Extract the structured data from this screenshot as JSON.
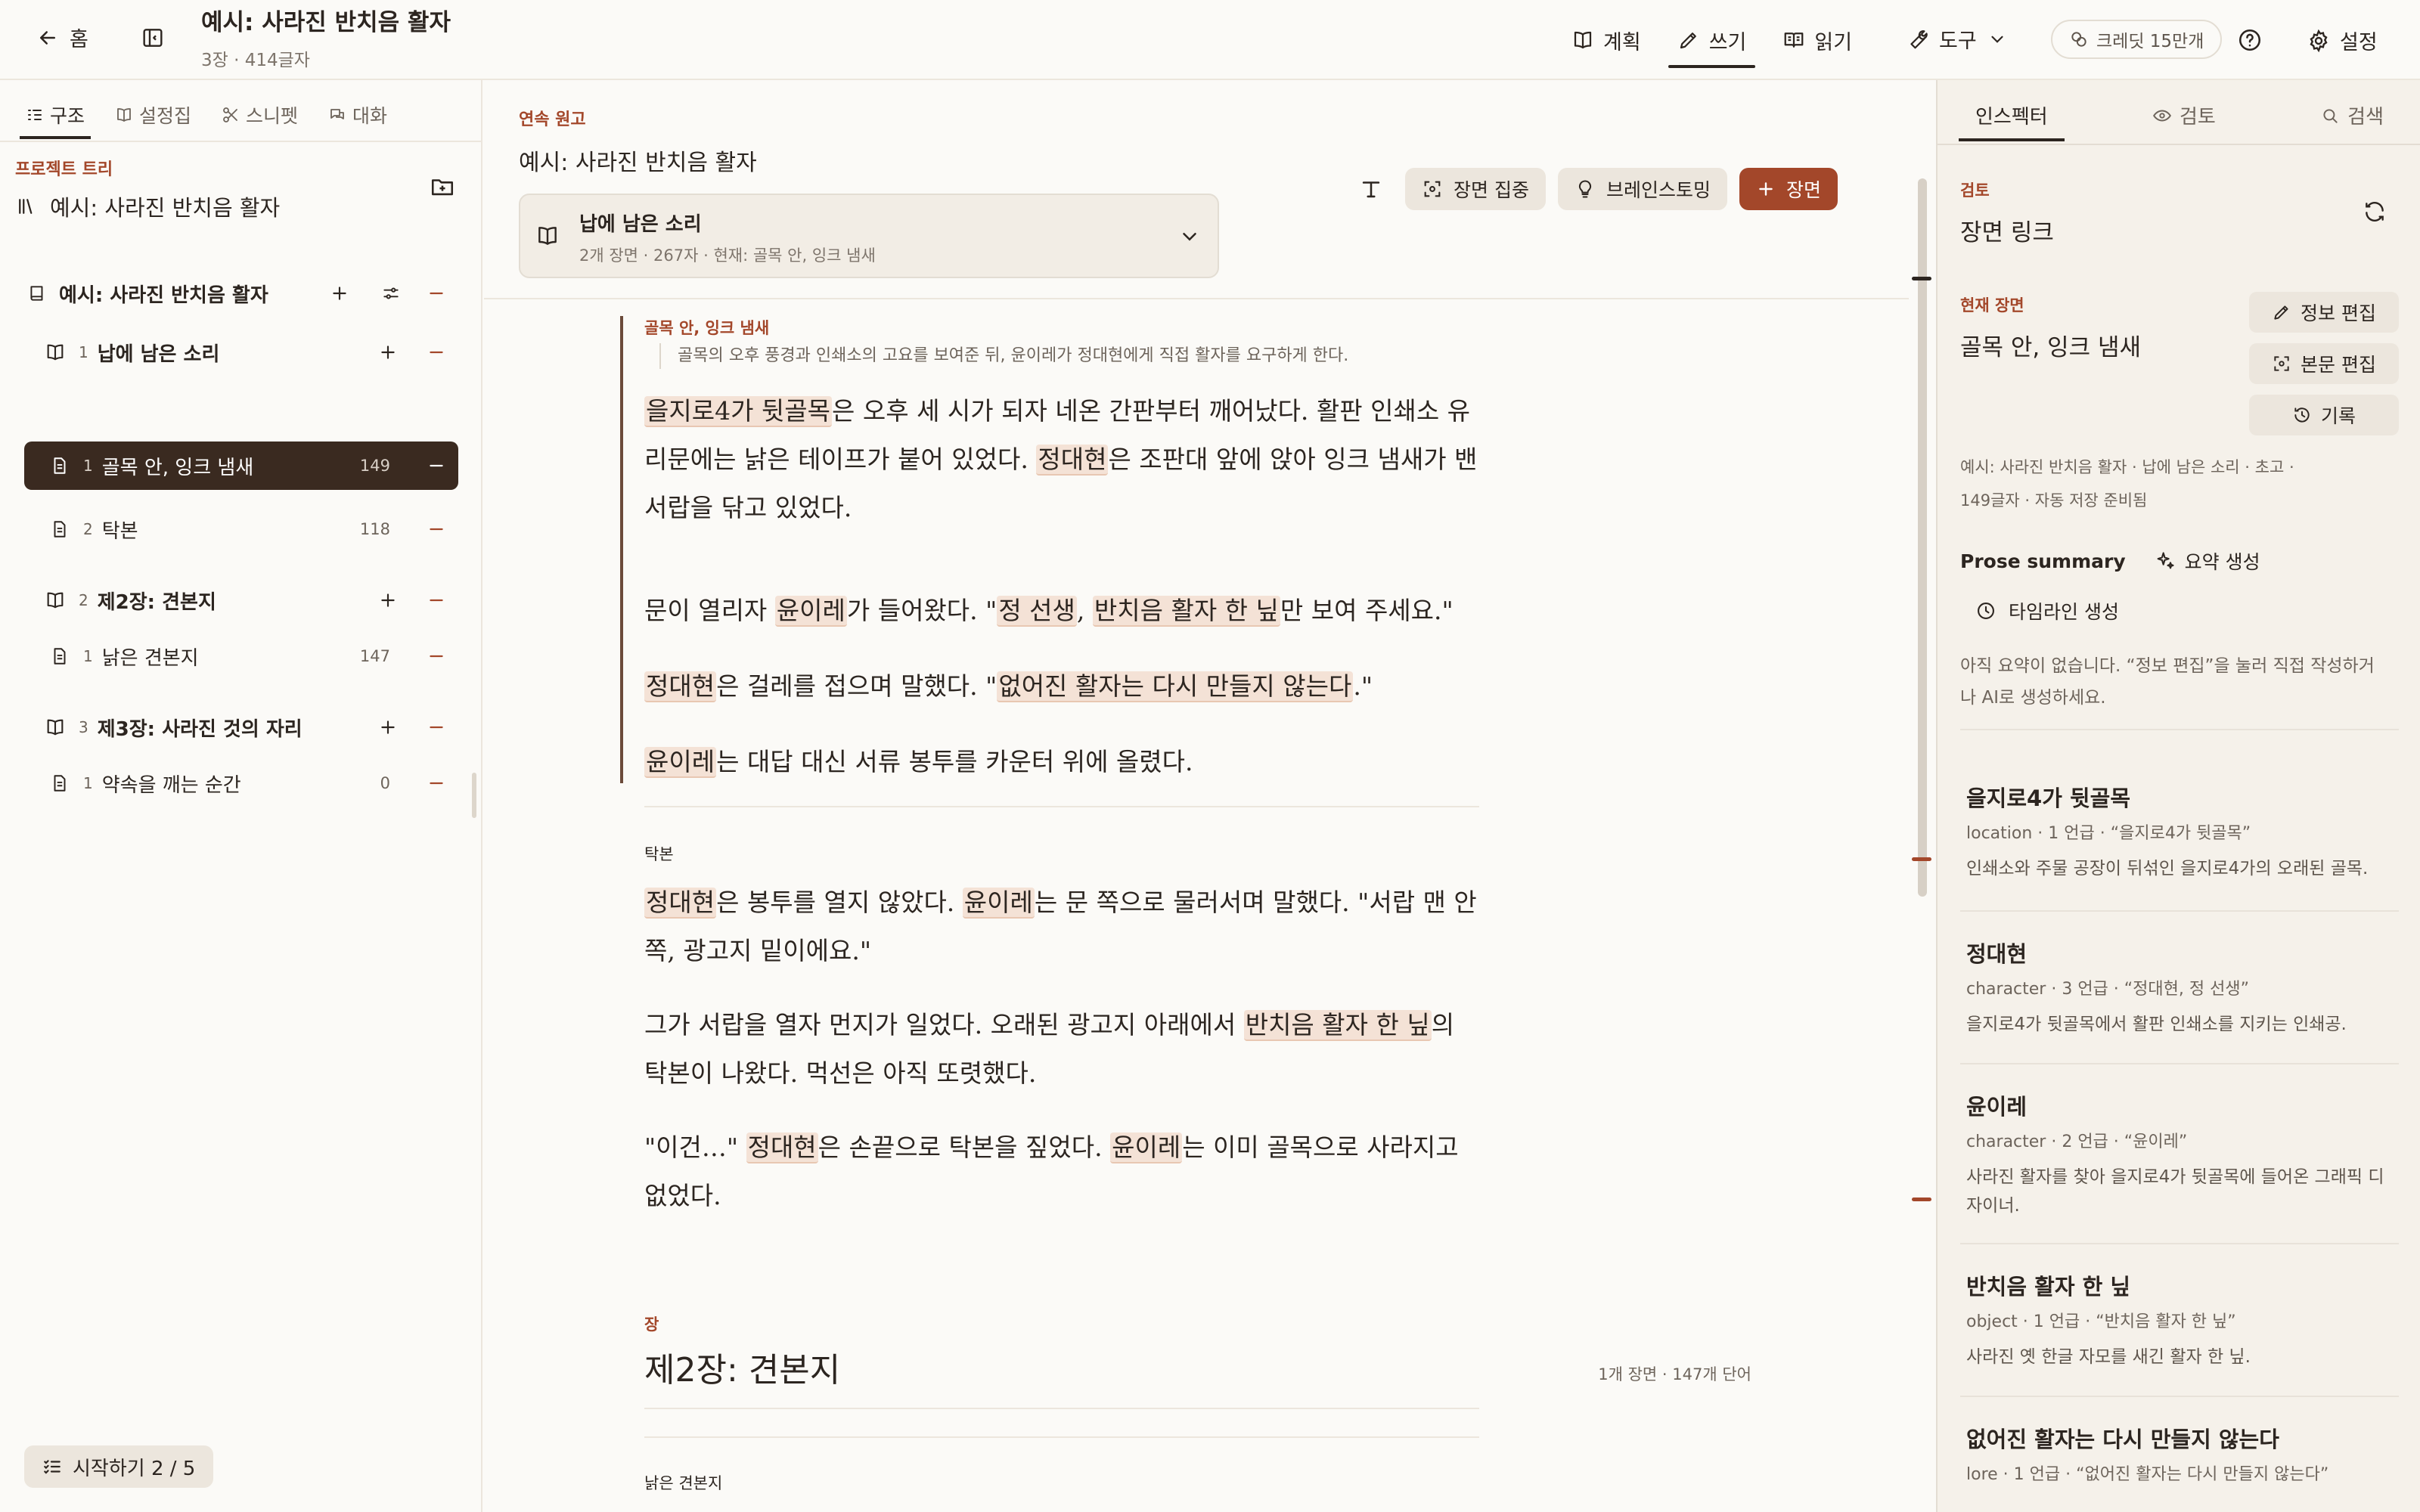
{
  "topbar": {
    "back_label": "홈",
    "title": "예시: 사라진 반치음 활자",
    "subtitle": "3장 · 414글자",
    "modes": [
      {
        "label": "계획",
        "icon": "book-open-icon"
      },
      {
        "label": "쓰기",
        "icon": "pencil-icon"
      },
      {
        "label": "읽기",
        "icon": "reader-icon"
      }
    ],
    "tools_label": "도구",
    "credit_label": "크레딧 15만개",
    "settings_label": "설정"
  },
  "sidebar": {
    "tabs": [
      "구조",
      "설정집",
      "스니펫",
      "대화"
    ],
    "tree_heading": "프로젝트 트리",
    "project_name": "예시: 사라진 반치음 활자",
    "book": {
      "label": "예시: 사라진 반치음 활자"
    },
    "chapters": [
      {
        "num": "1",
        "label": "납에 남은 소리",
        "scenes": [
          {
            "num": "1",
            "label": "골목 안, 잉크 냄새",
            "count": "149"
          },
          {
            "num": "2",
            "label": "탁본",
            "count": "118"
          }
        ]
      },
      {
        "num": "2",
        "label": "제2장: 견본지",
        "scenes": [
          {
            "num": "1",
            "label": "낡은 견본지",
            "count": "147"
          }
        ]
      },
      {
        "num": "3",
        "label": "제3장: 사라진 것의 자리",
        "scenes": [
          {
            "num": "1",
            "label": "약속을 깨는 순간",
            "count": "0"
          }
        ]
      }
    ],
    "start_label": "시작하기 2 / 5"
  },
  "editor": {
    "draft_label": "연속 원고",
    "draft_title": "예시: 사라진 반치음 활자",
    "chapter_select": {
      "title": "납에 남은 소리",
      "sub": "2개 장면 · 267자 · 현재: 골목 안, 잉크 냄새"
    },
    "actions": {
      "focus": "장면 집중",
      "brainstorm": "브레인스토밍",
      "add_scene": "장면"
    },
    "scene1": {
      "tag": "골목 안, 잉크 냄새",
      "desc": "골목의 오후 풍경과 인쇄소의 고요를 보여준 뒤, 윤이레가 정대현에게 직접 활자를 요구하게 한다.",
      "p1": {
        "a": "을지로4가 뒷골목",
        "b": "은 오후 세 시가 되자 네온 간판부터 깨어났다. 활판 인쇄소 유리문에는 낡은 테이프가 붙어 있었다. ",
        "c": "정대현",
        "d": "은 조판대 앞에 앉아 잉크 냄새가 밴 서랍을 닦고 있었다."
      },
      "p2": {
        "a": "문이 열리자 ",
        "b": "윤이레",
        "c": "가 들어왔다. \"",
        "d": "정 선생",
        "e": ", ",
        "f": "반치음 활자 한 닢",
        "g": "만 보여 주세요.\""
      },
      "p3": {
        "a": "정대현",
        "b": "은 걸레를 접으며 말했다. \"",
        "c": "없어진 활자는 다시 만들지 않는다",
        "d": ".\""
      },
      "p4": {
        "a": "윤이레",
        "b": "는 대답 대신 서류 봉투를 카운터 위에 올렸다."
      }
    },
    "scene2": {
      "tag": "탁본",
      "p1": {
        "a": "정대현",
        "b": "은 봉투를 열지 않았다. ",
        "c": "윤이레",
        "d": "는 문 쪽으로 물러서며 말했다. \"서랍 맨 안쪽, 광고지 밑이에요.\""
      },
      "p2": {
        "a": "그가 서랍을 열자 먼지가 일었다. 오래된 광고지 아래에서 ",
        "b": "반치음 활자 한 닢",
        "c": "의 탁본이 나왔다. 먹선은 아직 또렷했다."
      },
      "p3": {
        "a": "\"이건…\" ",
        "b": "정대현",
        "c": "은 손끝으로 탁본을 짚었다. ",
        "d": "윤이레",
        "e": "는 이미 골목으로 사라지고 없었다."
      }
    },
    "chapter2": {
      "tag": "장",
      "title": "제2장: 견본지",
      "meta": "1개 장면 · 147개 단어",
      "scene_tag": "낡은 견본지"
    }
  },
  "inspector": {
    "tabs": [
      "인스펙터",
      "검토",
      "검색"
    ],
    "review_label": "검토",
    "review_title": "장면 링크",
    "current_label": "현재 장면",
    "current_title": "골목 안, 잉크 냄새",
    "btn_info": "정보 편집",
    "btn_body": "본문 편집",
    "btn_history": "기록",
    "meta": [
      "예시: 사라진 반치음 활자",
      "납에 남은 소리",
      "초고",
      "149글자",
      "자동 저장 준비됨"
    ],
    "prose_summary_label": "Prose summary",
    "summary_gen": "요약 생성",
    "timeline_gen": "타임라인 생성",
    "note": "아직 요약이 없습니다. “정보 편집”을 눌러 직접 작성하거나 AI로 생성하세요.",
    "entities": [
      {
        "name": "을지로4가 뒷골목",
        "meta": "location · 1 언급 · “을지로4가 뒷골목”",
        "desc": "인쇄소와 주물 공장이 뒤섞인 을지로4가의 오래된 골목."
      },
      {
        "name": "정대현",
        "meta": "character · 3 언급 · “정대현, 정 선생”",
        "desc": "을지로4가 뒷골목에서 활판 인쇄소를 지키는 인쇄공."
      },
      {
        "name": "윤이레",
        "meta": "character · 2 언급 · “윤이레”",
        "desc": "사라진 활자를 찾아 을지로4가 뒷골목에 들어온 그래픽 디자이너."
      },
      {
        "name": "반치음 활자 한 닢",
        "meta": "object · 1 언급 · “반치음 활자 한 닢”",
        "desc": "사라진 옛 한글 자모를 새긴 활자 한 닢."
      },
      {
        "name": "없어진 활자는 다시 만들지 않는다",
        "meta": "lore · 1 언급 · “없어진 활자는 다시 만들지 않는다”",
        "desc": ""
      }
    ]
  },
  "colors": {
    "accent": "#a3472a",
    "selected_row": "#3a2a20",
    "highlight": "#f4e2d6",
    "panel_bg": "#f5f1ea"
  }
}
